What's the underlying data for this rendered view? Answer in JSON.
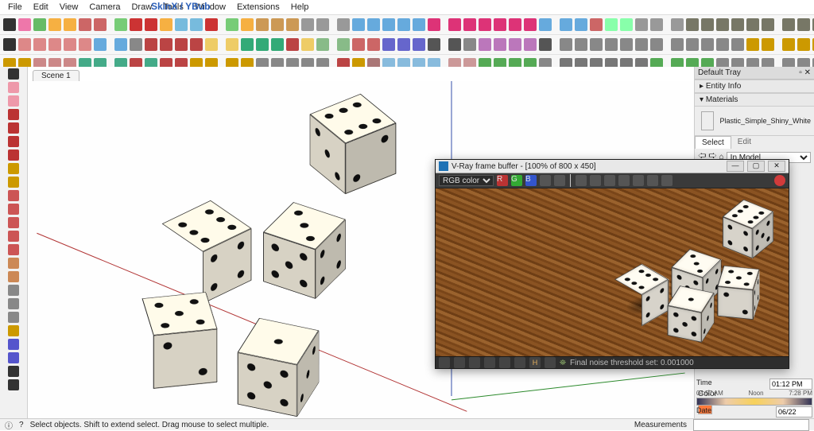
{
  "menu": {
    "items": [
      "File",
      "Edit",
      "View",
      "Camera",
      "Draw",
      "Tools",
      "Window",
      "Extensions",
      "Help"
    ]
  },
  "brand": "SkinX / YBub",
  "scene_tab": "Scene 1",
  "tray": {
    "title": "Default Tray",
    "panel1": "Entity Info",
    "panel2": "Materials",
    "material_name": "Plastic_Simple_Shiny_White",
    "tab_select": "Select",
    "tab_edit": "Edit",
    "browse_scope": "In Model",
    "color_label": "Color",
    "time_label": "Time",
    "time_start": "04:57 AM",
    "time_noon": "Noon",
    "time_end": "7:28 PM",
    "time_value": "01:12 PM",
    "date_label": "Date",
    "date_value": "06/22"
  },
  "status": {
    "hint": "Select objects. Shift to extend select. Drag mouse to select multiple.",
    "measurements_label": "Measurements"
  },
  "vfb": {
    "title": "V-Ray frame buffer - [100% of 800 x 450]",
    "channel": "RGB color",
    "channels_r": "R",
    "channels_g": "G",
    "channels_b": "B",
    "status": "Final noise threshold set: 0.001000"
  },
  "toolbar_colors": {
    "row1": [
      "#333",
      "#e7a",
      "#6b6",
      "#f6b042",
      "#f6b042",
      "#c66",
      "#c66",
      "#7c7",
      "#c33",
      "#c33",
      "#f6b042",
      "#7bd",
      "#7bd",
      "#c33",
      "#7c7",
      "#f6b042",
      "#c95",
      "#c95",
      "#c95",
      "#999",
      "#999",
      "#999",
      "#6ad",
      "#6ad",
      "#6ad",
      "#6ad",
      "#6ad",
      "#d37",
      "#d37",
      "#d37",
      "#d37",
      "#d37",
      "#d37",
      "#d37",
      "#6ad",
      "#6ad",
      "#6ad",
      "#c66",
      "#8fa",
      "#8fa",
      "#999",
      "#999",
      "#999",
      "#776",
      "#776",
      "#776",
      "#776",
      "#776",
      "#776",
      "#776",
      "#776",
      "#776",
      "#776",
      "#776",
      "#888",
      "#888"
    ],
    "row2": [
      "#333",
      "#d88",
      "#d88",
      "#d88",
      "#d88",
      "#d88",
      "#6ad",
      "#6ad",
      "#888",
      "#b44",
      "#b44",
      "#b44",
      "#b44",
      "#ec6",
      "#ec6",
      "#3a7",
      "#3a7",
      "#3a7",
      "#b44",
      "#ec6",
      "#8b8",
      "#8b8",
      "#c66",
      "#c66",
      "#66c",
      "#66c",
      "#66c",
      "#555",
      "#555",
      "#888",
      "#b7b",
      "#b7b",
      "#b7b",
      "#b7b",
      "#555",
      "#888",
      "#888",
      "#888",
      "#888",
      "#888",
      "#888",
      "#888",
      "#888",
      "#888",
      "#888",
      "#888",
      "#888",
      "#c90",
      "#c90",
      "#c90",
      "#c90",
      "#c90",
      "#c90",
      "#c90",
      "#c90",
      "#c90"
    ],
    "row3": [
      "#c90",
      "#c90",
      "#c88",
      "#c88",
      "#c88",
      "#4a8",
      "#4a8",
      "#4a8",
      "#b44",
      "#4a8",
      "#b44",
      "#b44",
      "#c90",
      "#c90",
      "#c90",
      "#c90",
      "#888",
      "#888",
      "#888",
      "#888",
      "#888",
      "#b44",
      "#c90",
      "#a77",
      "#8bd",
      "#8bd",
      "#8bd",
      "#8bd",
      "#c99",
      "#c99",
      "#5a5",
      "#5a5",
      "#5a5",
      "#5a5",
      "#888",
      "#777",
      "#777",
      "#777",
      "#777",
      "#777",
      "#777",
      "#5a5",
      "#5a5",
      "#5a5",
      "#5a5",
      "#888",
      "#888",
      "#888",
      "#888",
      "#888",
      "#888",
      "#888",
      "#888",
      "#888",
      "#888",
      "#888"
    ],
    "left": [
      "#333",
      "#e9a",
      "#e9a",
      "#b33",
      "#b33",
      "#b33",
      "#b33",
      "#c90",
      "#c90",
      "#c55",
      "#c55",
      "#c55",
      "#c55",
      "#c55",
      "#c85",
      "#c85",
      "#888",
      "#888",
      "#888",
      "#c90",
      "#55c",
      "#55c",
      "#333",
      "#333"
    ]
  }
}
